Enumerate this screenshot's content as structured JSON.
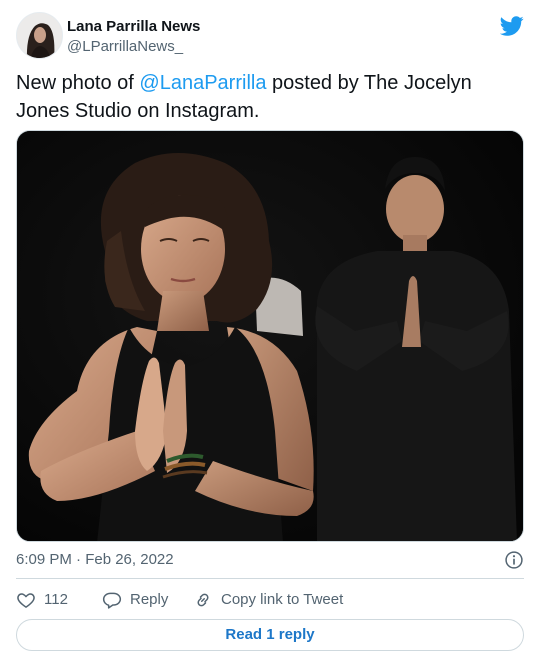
{
  "author": {
    "display_name": "Lana Parrilla News",
    "handle": "@LParrillaNews_"
  },
  "tweet": {
    "text_before": "New photo of ",
    "mention": "@LanaParrilla",
    "text_after": " posted by The Jocelyn Jones Studio on Instagram."
  },
  "meta": {
    "timestamp": "6:09 PM · Feb 26, 2022"
  },
  "actions": {
    "like_count": "112",
    "reply_label": "Reply",
    "copy_link_label": "Copy link to Tweet"
  },
  "read_replies": {
    "label": "Read 1 reply"
  },
  "icons": {
    "brand": "twitter-bird-icon",
    "info": "info-icon",
    "like": "heart-icon",
    "reply": "speech-bubble-icon",
    "copy_link": "link-icon"
  },
  "colors": {
    "accent": "#1d9bf0",
    "secondary_text": "#536471",
    "border": "#cfd9de"
  }
}
